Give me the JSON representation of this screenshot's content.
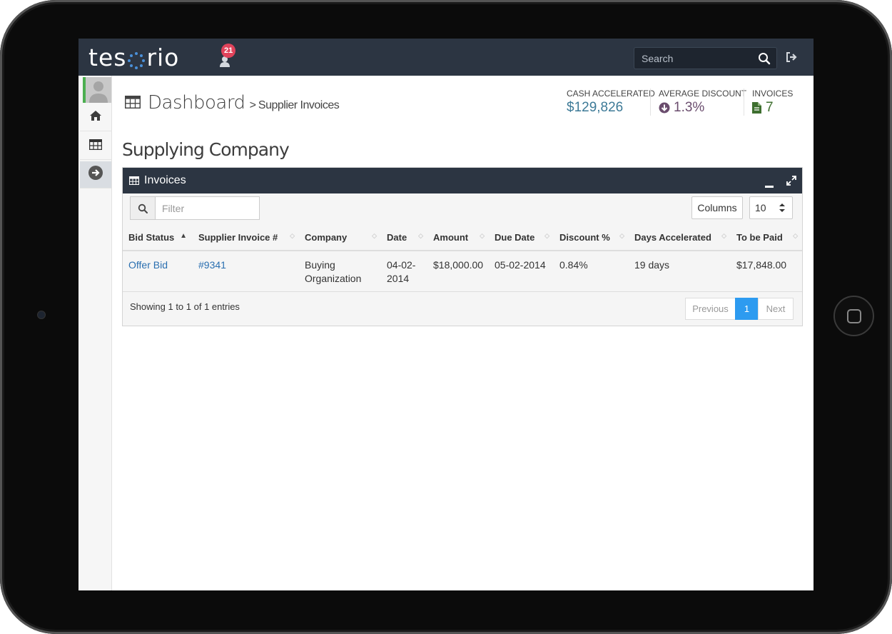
{
  "app": {
    "logo_text_left": "tes",
    "logo_text_right": "rio",
    "notification_count": "21",
    "search_placeholder": "Search"
  },
  "header": {
    "title": "Dashboard",
    "breadcrumb_separator": ">",
    "breadcrumb_current": "Supplier Invoices",
    "stats": [
      {
        "label": "CASH ACCELERATED",
        "value": "$129,826",
        "color": "#3d7a97"
      },
      {
        "label": "AVERAGE DISCOUNT",
        "value": "1.3%",
        "color": "#6a4c6d"
      },
      {
        "label": "INVOICES",
        "value": "7",
        "color": "#3e6f2f"
      }
    ]
  },
  "company": {
    "name": "Supplying Company"
  },
  "panel": {
    "title": "Invoices",
    "filter_placeholder": "Filter",
    "columns_button": "Columns",
    "page_size": "10",
    "table": {
      "headers": [
        "Bid Status",
        "Supplier Invoice #",
        "Company",
        "Date",
        "Amount",
        "Due Date",
        "Discount %",
        "Days Accelerated",
        "To be Paid"
      ],
      "rows": [
        {
          "bid_status": "Offer Bid",
          "invoice": "#9341",
          "company_line1": "Buying",
          "company_line2": "Organization",
          "date_line1": "04-02-",
          "date_line2": "2014",
          "amount": "$18,000.00",
          "due_date": "05-02-2014",
          "discount": "0.84%",
          "days_accelerated": "19 days",
          "to_be_paid": "$17,848.00"
        }
      ]
    },
    "footer": {
      "info": "Showing 1 to 1 of 1 entries",
      "previous": "Previous",
      "current_page": "1",
      "next": "Next"
    }
  },
  "icons": {
    "user": "user-icon",
    "search": "search-icon",
    "logout": "logout-icon",
    "home": "home-icon",
    "table": "table-icon",
    "arrow": "arrow-right-circle-icon",
    "minimize": "minus-icon",
    "expand": "expand-icon",
    "down_circle": "arrow-down-circle-icon",
    "file": "file-icon"
  }
}
